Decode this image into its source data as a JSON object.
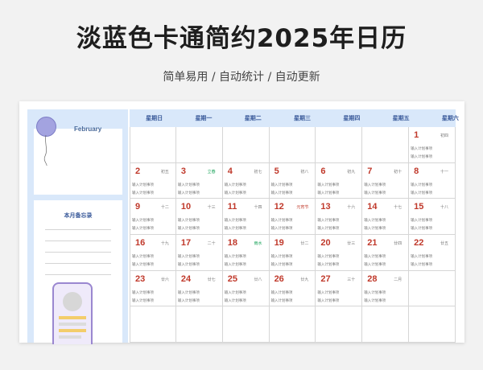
{
  "header": {
    "title": "淡蓝色卡通简约2025年日历",
    "subtitle": "简单易用 / 自动统计 / 自动更新"
  },
  "sidebar": {
    "month": "February",
    "memo_title": "本月备忘录"
  },
  "weekdays": [
    "星期日",
    "星期一",
    "星期二",
    "星期三",
    "星期四",
    "星期五",
    "星期六"
  ],
  "plan_placeholder": "输入计划事项",
  "days": [
    {
      "day": "1",
      "lunar": "初四",
      "lunar_color": "gray"
    },
    {
      "day": "2",
      "lunar": "初五",
      "lunar_color": "gray"
    },
    {
      "day": "3",
      "lunar": "立春",
      "lunar_color": "green"
    },
    {
      "day": "4",
      "lunar": "初七",
      "lunar_color": "gray"
    },
    {
      "day": "5",
      "lunar": "初八",
      "lunar_color": "gray"
    },
    {
      "day": "6",
      "lunar": "初九",
      "lunar_color": "gray"
    },
    {
      "day": "7",
      "lunar": "初十",
      "lunar_color": "gray"
    },
    {
      "day": "8",
      "lunar": "十一",
      "lunar_color": "gray"
    },
    {
      "day": "9",
      "lunar": "十二",
      "lunar_color": "gray"
    },
    {
      "day": "10",
      "lunar": "十三",
      "lunar_color": "gray"
    },
    {
      "day": "11",
      "lunar": "十四",
      "lunar_color": "gray"
    },
    {
      "day": "12",
      "lunar": "元宵节",
      "lunar_color": "red"
    },
    {
      "day": "13",
      "lunar": "十六",
      "lunar_color": "gray"
    },
    {
      "day": "14",
      "lunar": "十七",
      "lunar_color": "gray"
    },
    {
      "day": "15",
      "lunar": "十八",
      "lunar_color": "gray"
    },
    {
      "day": "16",
      "lunar": "十九",
      "lunar_color": "gray"
    },
    {
      "day": "17",
      "lunar": "二十",
      "lunar_color": "gray"
    },
    {
      "day": "18",
      "lunar": "雨水",
      "lunar_color": "green"
    },
    {
      "day": "19",
      "lunar": "廿二",
      "lunar_color": "gray"
    },
    {
      "day": "20",
      "lunar": "廿三",
      "lunar_color": "gray"
    },
    {
      "day": "21",
      "lunar": "廿四",
      "lunar_color": "gray"
    },
    {
      "day": "22",
      "lunar": "廿五",
      "lunar_color": "gray"
    },
    {
      "day": "23",
      "lunar": "廿六",
      "lunar_color": "gray"
    },
    {
      "day": "24",
      "lunar": "廿七",
      "lunar_color": "gray"
    },
    {
      "day": "25",
      "lunar": "廿八",
      "lunar_color": "gray"
    },
    {
      "day": "26",
      "lunar": "廿九",
      "lunar_color": "gray"
    },
    {
      "day": "27",
      "lunar": "三十",
      "lunar_color": "gray"
    },
    {
      "day": "28",
      "lunar": "二月",
      "lunar_color": "gray"
    }
  ],
  "colors": {
    "accent_blue": "#d9e8fa",
    "day_red": "#c0392b",
    "solar_term_green": "#1aa35a"
  }
}
